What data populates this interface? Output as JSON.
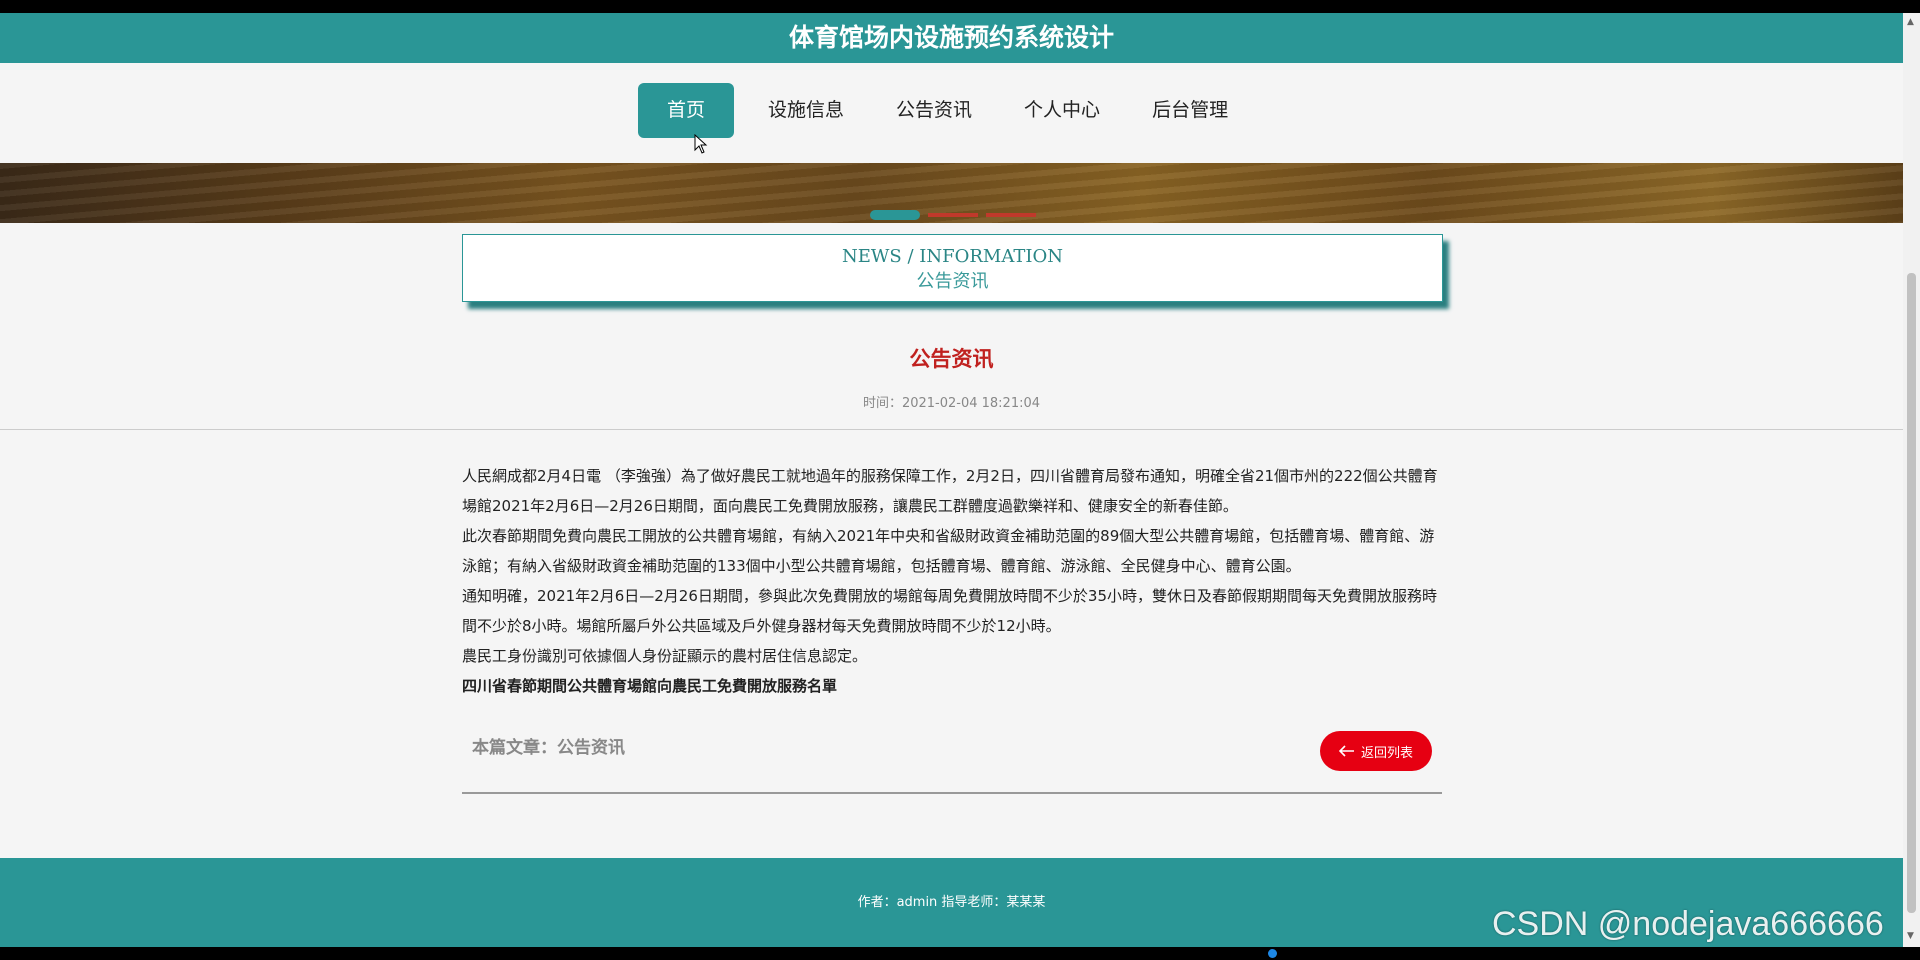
{
  "header": {
    "title": "体育馆场内设施预约系统设计"
  },
  "nav": {
    "items": [
      {
        "label": "首页",
        "active": true
      },
      {
        "label": "设施信息",
        "active": false
      },
      {
        "label": "公告资讯",
        "active": false
      },
      {
        "label": "个人中心",
        "active": false
      },
      {
        "label": "后台管理",
        "active": false
      }
    ]
  },
  "news_box": {
    "en": "NEWS / INFORMATION",
    "cn": "公告资讯"
  },
  "article": {
    "title": "公告资讯",
    "time": "时间：2021-02-04 18:21:04",
    "paragraphs": [
      "人民網成都2月4日電 （李強強）為了做好農民工就地過年的服務保障工作，2月2日，四川省體育局發布通知，明確全省21個市州的222個公共體育場館2021年2月6日—2月26日期間，面向農民工免費開放服務，讓農民工群體度過歡樂祥和、健康安全的新春佳節。",
      "此次春節期間免費向農民工開放的公共體育場館，有納入2021年中央和省級財政資金補助范圍的89個大型公共體育場館，包括體育場、體育館、游泳館；有納入省級財政資金補助范圍的133個中小型公共體育場館，包括體育場、體育館、游泳館、全民健身中心、體育公園。",
      "通知明確，2021年2月6日—2月26日期間，參與此次免費開放的場館每周免費開放時間不少於35小時，雙休日及春節假期期間每天免費開放服務時間不少於8小時。場館所屬戶外公共區域及戶外健身器材每天免費開放時間不少於12小時。",
      "農民工身份識別可依據個人身份証顯示的農村居住信息認定。"
    ],
    "bold_line": "四川省春節期間公共體育場館向農民工免費開放服務名單",
    "category": "本篇文章：公告资讯",
    "back_label": "返回列表"
  },
  "footer": {
    "text": "作者：admin 指导老师：某某某"
  },
  "watermark": "CSDN @nodejava666666",
  "colors": {
    "primary": "#2a9696",
    "accent_red": "#e60012",
    "title_red": "#c0211f"
  },
  "icons": {
    "cursor": "mouse-pointer-icon",
    "back": "arrow-left-icon"
  }
}
